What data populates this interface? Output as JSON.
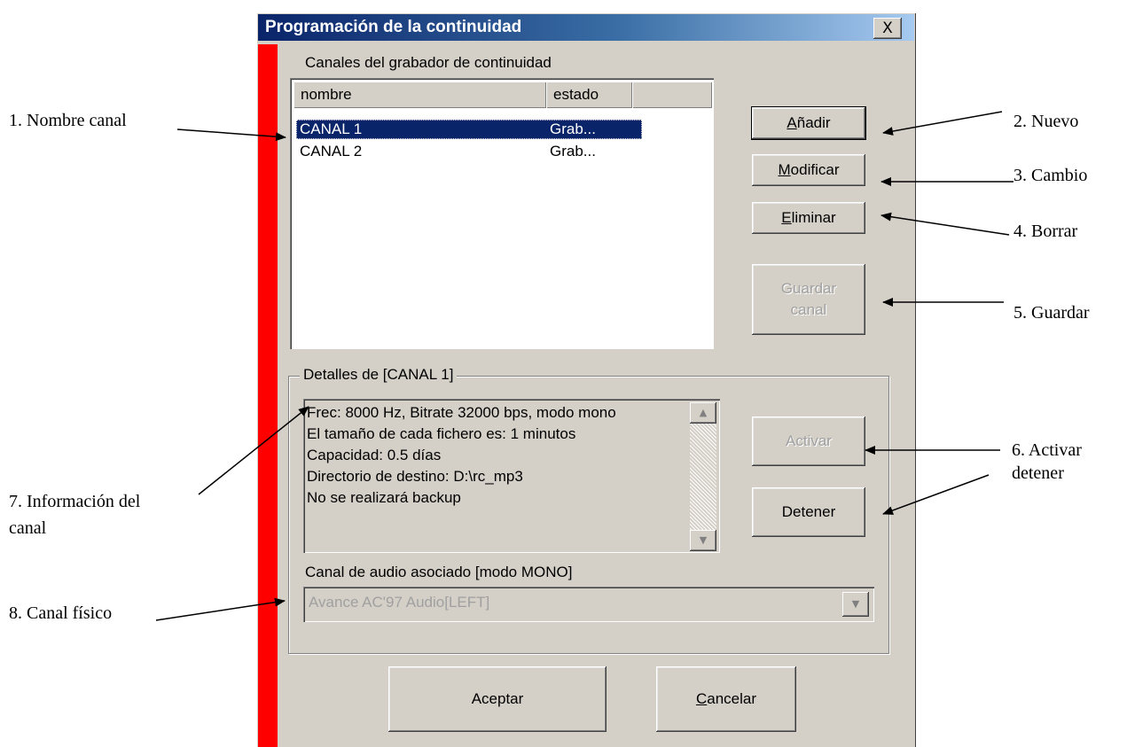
{
  "dialog": {
    "title": "Programación de la continuidad",
    "close_label": "X",
    "channels_label": "Canales del grabador de continuidad",
    "columns": [
      "nombre",
      "estado"
    ],
    "rows": [
      {
        "name": "CANAL 1",
        "state": "Grab...",
        "selected": true
      },
      {
        "name": "CANAL 2",
        "state": "Grab...",
        "selected": false
      }
    ],
    "buttons": {
      "add_pre": "",
      "add_u": "A",
      "add_post": "ñadir",
      "modify_u": "M",
      "modify_post": "odificar",
      "delete_u": "E",
      "delete_post": "liminar",
      "save_line1": "Guardar",
      "save_line2": "canal",
      "activate": "Activar",
      "stop": "Detener",
      "accept": "Aceptar",
      "cancel_u": "C",
      "cancel_post": "ancelar"
    },
    "details_title": "Detalles de [CANAL 1]",
    "details_lines": [
      "Frec: 8000 Hz, Bitrate 32000 bps, modo mono",
      "El tamaño de cada fichero es: 1 minutos",
      "Capacidad: 0.5 días",
      "Directorio de destino: D:\\rc_mp3",
      "No se realizará backup"
    ],
    "audio_label": "Canal de audio asociado [modo MONO]",
    "audio_value": "Avance AC'97 Audio[LEFT]"
  },
  "annotations": {
    "a1": "1. Nombre canal",
    "a2": "2. Nuevo",
    "a3": "3. Cambio",
    "a4": "4. Borrar",
    "a5": "5. Guardar",
    "a6_line1": "6. Activar",
    "a6_line2": "detener",
    "a7_line1": "7. Información del",
    "a7_line2": "canal",
    "a8": "8. Canal físico"
  },
  "colors": {
    "face": "#d4d0c8",
    "selection": "#0a246a",
    "title_gradient_start": "#0a246a",
    "sidebar_red": "#ff0000",
    "disabled_text": "#a0a0a0"
  }
}
